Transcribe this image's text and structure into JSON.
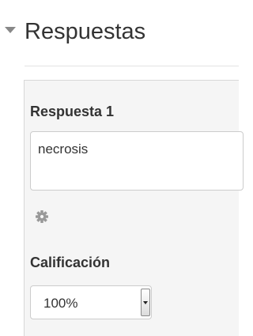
{
  "section": {
    "title": "Respuestas",
    "toggle_icon": "triangle-down-icon"
  },
  "answer": {
    "label": "Respuesta 1",
    "value": "necrosis",
    "settings_icon": "gear-icon"
  },
  "grade": {
    "label": "Calificación",
    "selected_value": "100%"
  },
  "colors": {
    "panel_background": "#f5f5f5",
    "panel_border": "#d8d8d8",
    "text": "#333333",
    "icon": "#888888"
  }
}
